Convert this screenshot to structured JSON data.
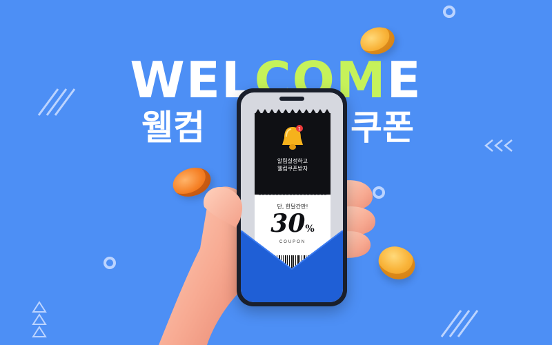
{
  "headline": {
    "part1": "WEL",
    "highlight": "COM",
    "part2": "E"
  },
  "korean": {
    "left": "웰컴",
    "right": "쿠폰"
  },
  "coupon": {
    "notice_line1": "알림설정하고",
    "notice_line2": "웰컴쿠폰받자",
    "limit_note": "단, 한달간만!",
    "discount_number": "30",
    "discount_unit": "%",
    "label": "COUPON"
  },
  "colors": {
    "background": "#4d8ff5",
    "highlight": "#c6f25a",
    "envelope": "#1f5fd6",
    "coin_gold": "#f9b43a",
    "coin_orange": "#f57e22"
  },
  "icons": {
    "bell": "bell-icon",
    "decorative": [
      "ring-icon",
      "slashes-icon",
      "chevron-left-icon",
      "triangle-stack-icon"
    ]
  }
}
